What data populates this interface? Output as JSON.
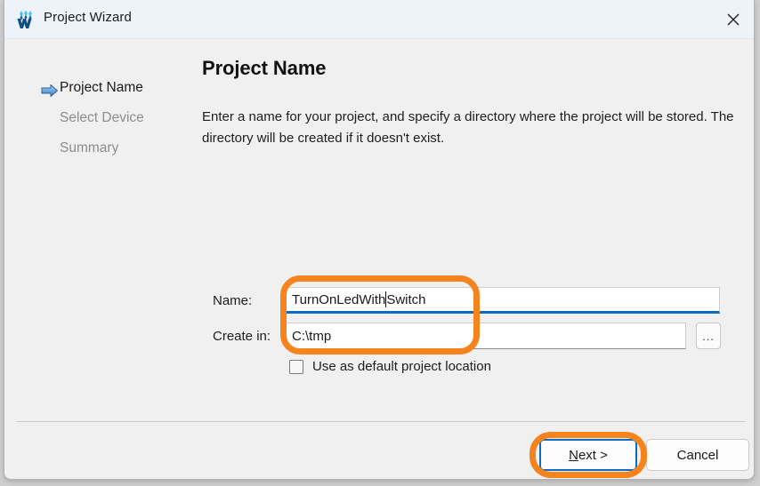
{
  "window": {
    "title": "Project Wizard",
    "app_icon": "wokwi-w-logo-icon",
    "close_icon": "close-icon"
  },
  "sidebar": {
    "current_step_indicator_icon": "blue-right-arrow-icon",
    "steps": [
      {
        "label": "Project Name",
        "state": "active"
      },
      {
        "label": "Select Device",
        "state": "inactive"
      },
      {
        "label": "Summary",
        "state": "inactive"
      }
    ]
  },
  "main": {
    "title": "Project Name",
    "description": "Enter a name for your project, and specify a directory where the project will be stored. The directory will be created if it doesn't exist."
  },
  "form": {
    "name": {
      "label": "Name:",
      "value": "TurnOnLedWith",
      "value_after_caret": "Switch",
      "full_value": "TurnOnLedWithSwitch",
      "placeholder": "",
      "focused": true
    },
    "create_in": {
      "label": "Create in:",
      "value": "C:\\tmp",
      "placeholder": "",
      "browse_label": "...",
      "browse_icon": "ellipsis-icon"
    },
    "default_location_checkbox": {
      "label": "Use as default project location",
      "checked": false
    }
  },
  "footer": {
    "buttons": [
      {
        "label": "Next >",
        "mnemonic": "N",
        "rest": "ext >",
        "focused": true
      },
      {
        "label": "Cancel",
        "focused": false
      }
    ]
  },
  "annotations": {
    "color": "#f5841f",
    "highlights": [
      {
        "target": "name-and-create-in-fields",
        "shape": "rounded-rectangle"
      },
      {
        "target": "next-button",
        "shape": "rounded-rectangle"
      }
    ]
  }
}
